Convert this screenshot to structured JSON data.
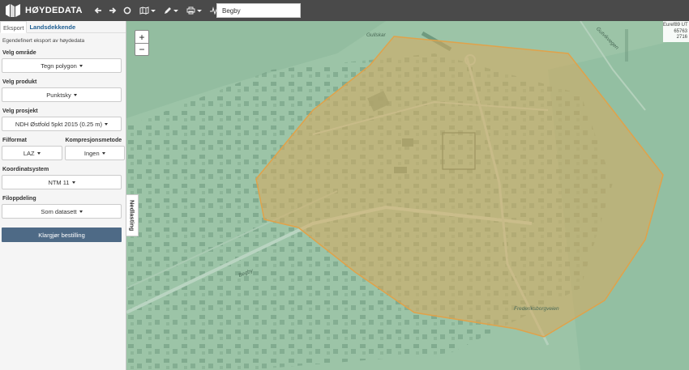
{
  "app": {
    "title": "HØYDEDATA"
  },
  "toolbar": {
    "search_value": "Begby"
  },
  "sidebar": {
    "tabs": [
      "Eksport",
      "Landsdekkende"
    ],
    "description": "Egendefinert eksport av høydedata",
    "area": {
      "label": "Velg område",
      "value": "Tegn polygon"
    },
    "product": {
      "label": "Velg produkt",
      "value": "Punktsky"
    },
    "project": {
      "label": "Velg prosjekt",
      "value": "NDH Østfold 5pkt 2015 (0.25 m)"
    },
    "file_format": {
      "label": "Filformat",
      "value": "LAZ"
    },
    "compression": {
      "label": "Kompresjonsmetode",
      "value": "Ingen"
    },
    "coordinate_system": {
      "label": "Koordinatsystem",
      "value": "NTM 11"
    },
    "file_split": {
      "label": "Filoppdeling",
      "value": "Som datasett"
    },
    "submit_label": "Klargjør bestilling"
  },
  "map": {
    "zoom_in": "+",
    "zoom_out": "−",
    "download_tab": "Nedlasting",
    "coords": [
      "Euref89 UT",
      "65763",
      "2716"
    ],
    "place_labels": [
      "Gullskar",
      "Begby",
      "Frederiksborgveien",
      "Gutvikvegen"
    ]
  },
  "colors": {
    "topbar": "#4a4a4a",
    "primary_button": "#4e6a86",
    "polygon_fill": "#d9a95c",
    "polygon_stroke": "#e0a24a",
    "map_base": "#9cc4a7"
  },
  "icons": [
    "logo-mark",
    "arrow-left-icon",
    "arrow-right-icon",
    "circle-icon",
    "map-icon",
    "pencil-icon",
    "printer-icon",
    "profile-icon"
  ]
}
